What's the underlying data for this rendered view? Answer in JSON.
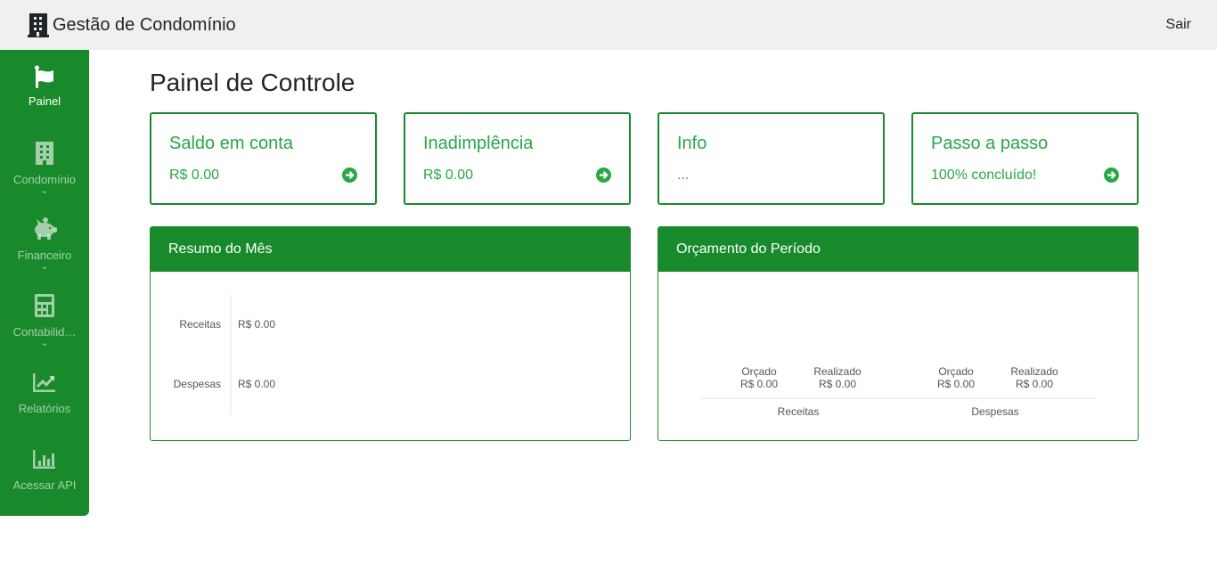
{
  "header": {
    "title": "Gestão de Condomínio",
    "logout_label": "Sair",
    "brand_icon": "building-icon"
  },
  "sidebar": {
    "items": [
      {
        "label": "Painel",
        "icon": "flag-icon",
        "active": true
      },
      {
        "label": "Condomínio",
        "icon": "building-icon",
        "expandable": true
      },
      {
        "label": "Financeiro",
        "icon": "piggy-bank-icon",
        "expandable": true
      },
      {
        "label": "Contabilid…",
        "icon": "calculator-icon",
        "expandable": true
      },
      {
        "label": "Relatórios",
        "icon": "chart-line-icon"
      },
      {
        "label": "Acessar API",
        "icon": "chart-bar-icon"
      }
    ],
    "expand_glyph": "⌄"
  },
  "main": {
    "title": "Painel de Controle",
    "cards": [
      {
        "title": "Saldo em conta",
        "value": "R$ 0.00",
        "has_arrow": true
      },
      {
        "title": "Inadimplência",
        "value": "R$ 0.00",
        "has_arrow": true
      },
      {
        "title": "Info",
        "value": "...",
        "has_arrow": false
      },
      {
        "title": "Passo a passo",
        "value": "100% concluído!",
        "has_arrow": true
      }
    ],
    "panels": [
      {
        "title": "Resumo do Mês"
      },
      {
        "title": "Orçamento do Período"
      }
    ]
  },
  "colors": {
    "brand_green": "#198a2b",
    "text_green": "#28a745",
    "topbar_bg": "#f1f0f0"
  },
  "chart_data": [
    {
      "type": "bar",
      "orientation": "horizontal",
      "categories": [
        "Receitas",
        "Despesas"
      ],
      "values": [
        0,
        0
      ],
      "value_labels": [
        "R$ 0.00",
        "R$ 0.00"
      ]
    },
    {
      "type": "bar",
      "groups": [
        "Receitas",
        "Despesas"
      ],
      "series": [
        {
          "name": "Orçado",
          "values": [
            0,
            0
          ],
          "value_labels": [
            "R$ 0.00",
            "R$ 0.00"
          ]
        },
        {
          "name": "Realizado",
          "values": [
            0,
            0
          ],
          "value_labels": [
            "R$ 0.00",
            "R$ 0.00"
          ]
        }
      ]
    }
  ]
}
